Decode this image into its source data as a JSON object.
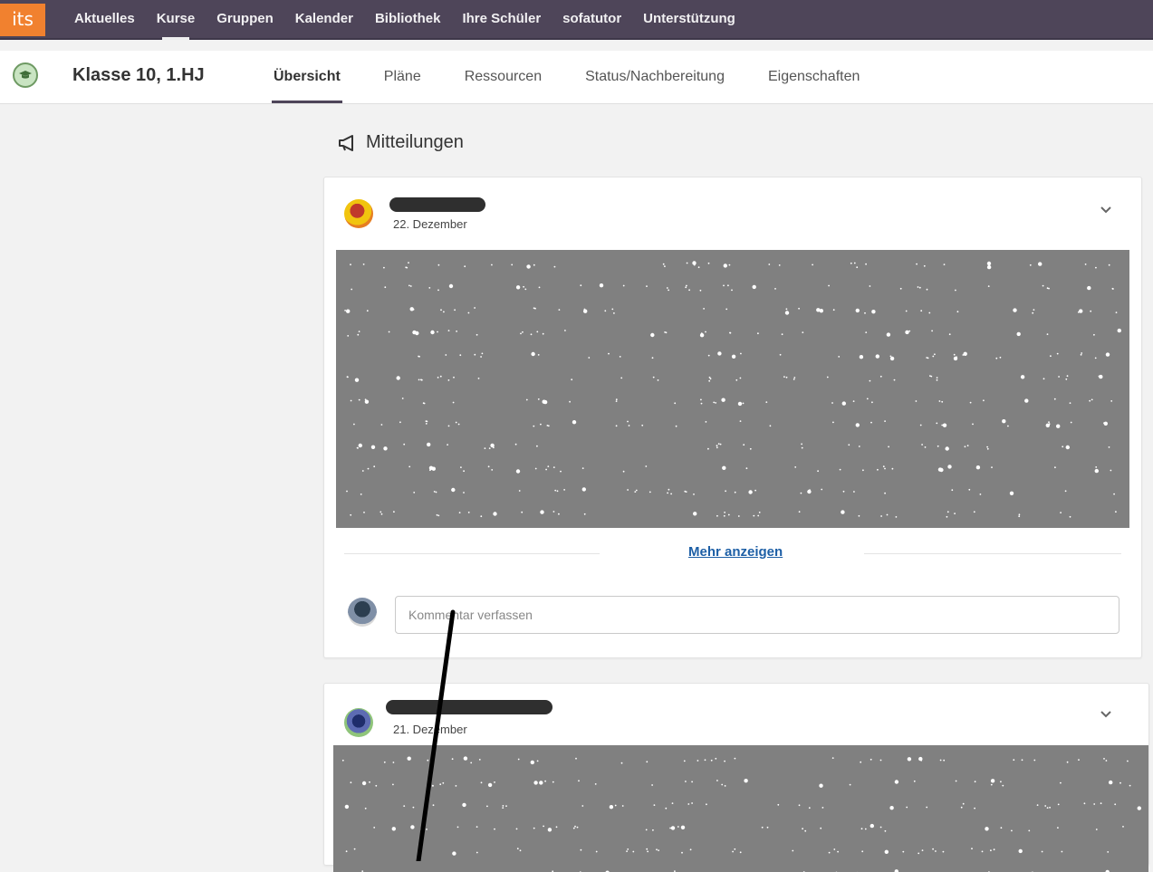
{
  "app": {
    "logo_text": "its"
  },
  "topnav": {
    "items": [
      "Aktuelles",
      "Kurse",
      "Gruppen",
      "Kalender",
      "Bibliothek",
      "Ihre Schüler",
      "sofatutor",
      "Unterstützung"
    ],
    "active": "Kurse"
  },
  "course": {
    "title": "Klasse 10, 1.HJ",
    "tabs": [
      "Übersicht",
      "Pläne",
      "Ressourcen",
      "Status/Nachbereitung",
      "Eigenschaften"
    ],
    "active_tab": "Übersicht"
  },
  "announcements": {
    "heading": "Mitteilungen",
    "posts": [
      {
        "date": "22. Dezember",
        "more_label": "Mehr anzeigen",
        "comment_placeholder": "Kommentar verfassen"
      },
      {
        "date": "21. Dezember"
      }
    ]
  },
  "colors": {
    "nav_bg": "#4e4559",
    "logo_bg": "#f1812f",
    "redacted_block": "#808080",
    "link": "#1d5fa6"
  },
  "icons": [
    "graduation-cap-icon",
    "megaphone-icon",
    "chevron-down-icon"
  ]
}
